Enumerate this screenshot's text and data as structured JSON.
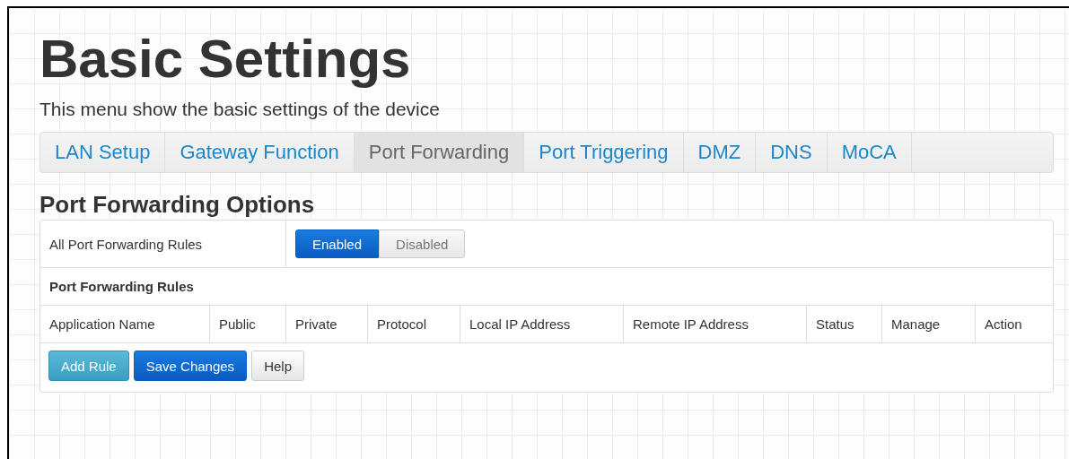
{
  "page": {
    "title": "Basic Settings",
    "subtitle": "This menu show the basic settings of the device"
  },
  "tabs": [
    {
      "label": "LAN Setup",
      "selected": false
    },
    {
      "label": "Gateway Function",
      "selected": false
    },
    {
      "label": "Port Forwarding",
      "selected": true
    },
    {
      "label": "Port Triggering",
      "selected": false
    },
    {
      "label": "DMZ",
      "selected": false
    },
    {
      "label": "DNS",
      "selected": false
    },
    {
      "label": "MoCA",
      "selected": false
    }
  ],
  "section": {
    "title": "Port Forwarding Options",
    "all_rules_label": "All Port Forwarding Rules",
    "toggle": [
      {
        "label": "Enabled",
        "selected": true
      },
      {
        "label": "Disabled",
        "selected": false
      }
    ],
    "rules_label": "Port Forwarding Rules"
  },
  "table": {
    "columns": [
      "Application Name",
      "Public",
      "Private",
      "Protocol",
      "Local IP Address",
      "Remote IP Address",
      "Status",
      "Manage",
      "Action"
    ]
  },
  "buttons": [
    {
      "label": "Add Rule",
      "kind": "info"
    },
    {
      "label": "Save Changes",
      "kind": "primary"
    },
    {
      "label": "Help",
      "kind": "default"
    }
  ]
}
